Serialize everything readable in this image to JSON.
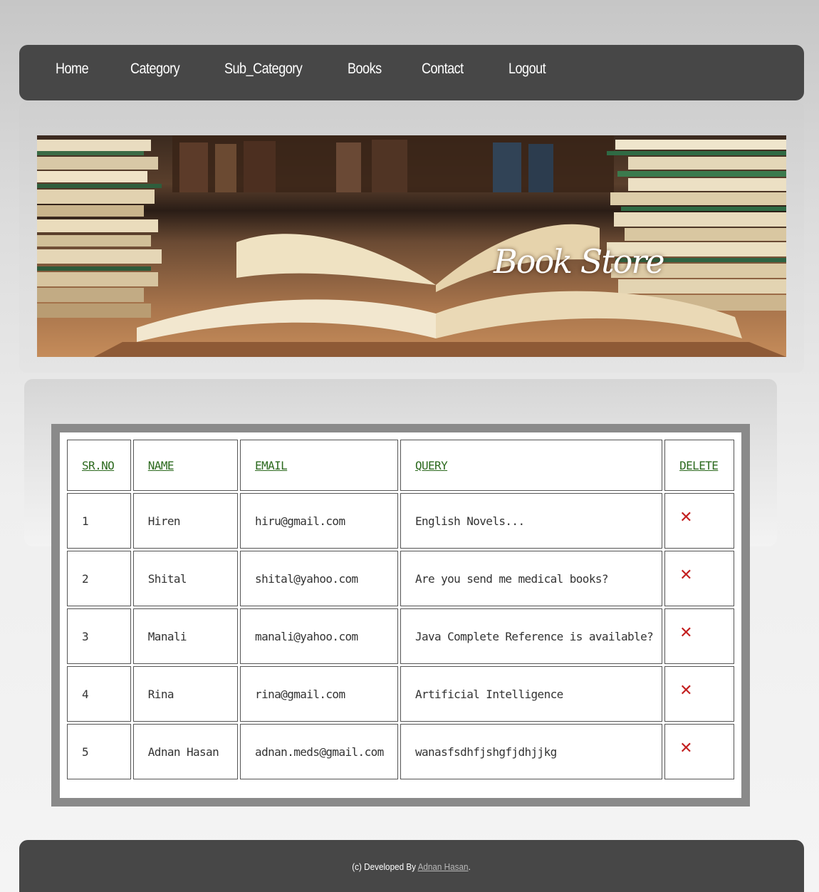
{
  "nav": {
    "items": [
      {
        "label": "Home"
      },
      {
        "label": "Category"
      },
      {
        "label": "Sub_Category"
      },
      {
        "label": "Books"
      },
      {
        "label": "Contact"
      },
      {
        "label": "Logout"
      }
    ]
  },
  "banner": {
    "title": "Book Store"
  },
  "table": {
    "headers": [
      "SR.NO",
      "NAME",
      "EMAIL",
      "QUERY",
      "DELETE"
    ],
    "rows": [
      {
        "srno": "1",
        "name": "Hiren",
        "email": "hiru@gmail.com",
        "query": "English Novels..."
      },
      {
        "srno": "2",
        "name": "Shital",
        "email": "shital@yahoo.com",
        "query": "Are you send me medical books?"
      },
      {
        "srno": "3",
        "name": "Manali",
        "email": "manali@yahoo.com",
        "query": "Java Complete Reference is available?"
      },
      {
        "srno": "4",
        "name": "Rina",
        "email": "rina@gmail.com",
        "query": "Artificial Intelligence"
      },
      {
        "srno": "5",
        "name": "Adnan Hasan",
        "email": "adnan.meds@gmail.com",
        "query": "wanasfsdhfjshgfjdhjjkg"
      }
    ],
    "delete_icon": "✕"
  },
  "footer": {
    "prefix": "(c) Developed By ",
    "author": "Adnan Hasan",
    "suffix": "."
  },
  "colors": {
    "nav_bg": "#474747",
    "header_link": "#2d6a1f",
    "delete_icon": "#c31f1f"
  }
}
